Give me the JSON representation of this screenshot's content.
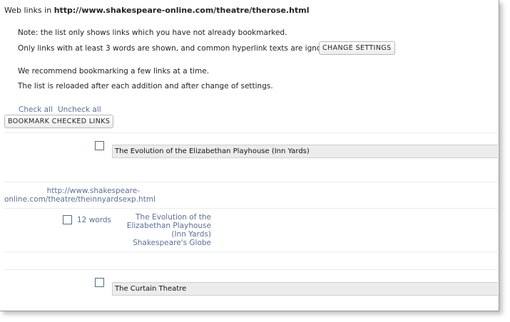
{
  "header": {
    "prefix": "Web links in ",
    "url": "http://www.shakespeare-online.com/theatre/therose.html"
  },
  "notes": {
    "line1": "Note: the list only shows links which you have not already bookmarked.",
    "line2": "Only links with at least 3 words are shown, and common hyperlink texts are ignored.",
    "change_settings": "CHANGE SETTINGS",
    "line3": "We recommend bookmarking a few links at a time.",
    "line4": "The list is reloaded after each addition and after change of settings."
  },
  "actions": {
    "check_all": "Check all",
    "uncheck_all": "Uncheck all",
    "bookmark_checked": "BOOKMARK CHECKED LINKS"
  },
  "items": [
    {
      "title": "The Evolution of the Elizabethan Playhouse (Inn Yards)",
      "url": "http://www.shakespeare-online.com/theatre/theinnyardsexp.html",
      "words": "12 words",
      "anchor_text": "The Evolution of the Elizabethan Playhouse (Inn Yards)  Shakespeare's Globe",
      "checked": false
    },
    {
      "title": "The Curtain Theatre",
      "checked": false
    }
  ]
}
